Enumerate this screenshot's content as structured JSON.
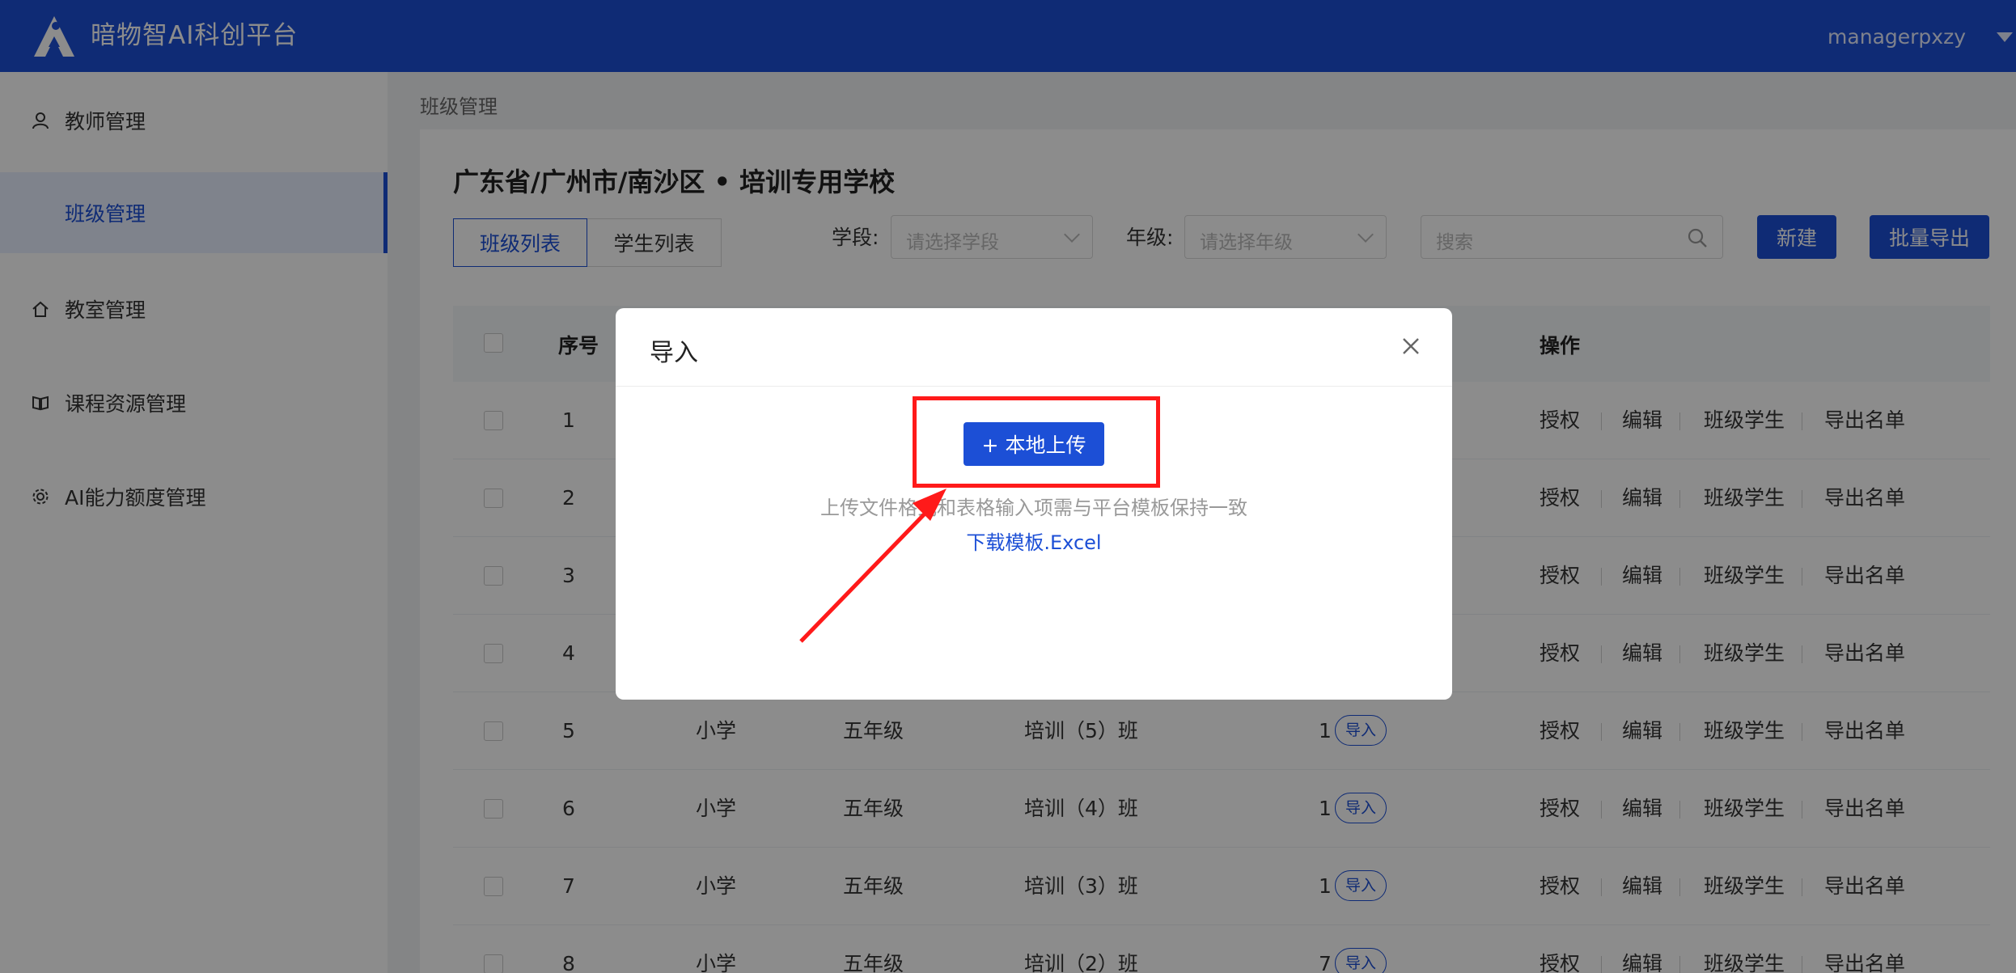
{
  "header": {
    "app_title": "暗物智AI科创平台",
    "user_name": "managerpxzy"
  },
  "sidebar": {
    "items": [
      {
        "label": "教师管理",
        "icon": "user-icon"
      },
      {
        "label": "班级管理",
        "icon": "",
        "active": true
      },
      {
        "label": "教室管理",
        "icon": "home-icon"
      },
      {
        "label": "课程资源管理",
        "icon": "book-icon"
      },
      {
        "label": "AI能力额度管理",
        "icon": "gear-icon"
      }
    ]
  },
  "breadcrumb": "班级管理",
  "main": {
    "school_title": "广东省/广州市/南沙区 • 培训专用学校",
    "tabs": [
      {
        "label": "班级列表",
        "active": true
      },
      {
        "label": "学生列表",
        "active": false
      }
    ],
    "filters": {
      "stage_label": "学段:",
      "stage_placeholder": "请选择学段",
      "grade_label": "年级:",
      "grade_placeholder": "请选择年级",
      "search_placeholder": "搜索"
    },
    "buttons": {
      "new": "新建",
      "export": "批量导出"
    }
  },
  "table": {
    "headers": {
      "index": "序号",
      "actions": "操作"
    },
    "import_label": "导入",
    "actions": [
      "授权",
      "编辑",
      "班级学生",
      "导出名单"
    ],
    "rows": [
      {
        "index": "1",
        "stage": "",
        "grade": "",
        "class_name": "",
        "count": ""
      },
      {
        "index": "2",
        "stage": "",
        "grade": "",
        "class_name": "",
        "count": ""
      },
      {
        "index": "3",
        "stage": "",
        "grade": "",
        "class_name": "",
        "count": ""
      },
      {
        "index": "4",
        "stage": "",
        "grade": "",
        "class_name": "",
        "count": ""
      },
      {
        "index": "5",
        "stage": "小学",
        "grade": "五年级",
        "class_name": "培训（5）班",
        "count": "1"
      },
      {
        "index": "6",
        "stage": "小学",
        "grade": "五年级",
        "class_name": "培训（4）班",
        "count": "1"
      },
      {
        "index": "7",
        "stage": "小学",
        "grade": "五年级",
        "class_name": "培训（3）班",
        "count": "1"
      },
      {
        "index": "8",
        "stage": "小学",
        "grade": "五年级",
        "class_name": "培训（2）班",
        "count": "7"
      }
    ]
  },
  "modal": {
    "title": "导入",
    "upload_label": "+ 本地上传",
    "hint": "上传文件格式和表格输入项需与平台模板保持一致",
    "template_link": "下载模板.Excel"
  },
  "colors": {
    "brand": "#1c4fd6",
    "annotation": "#ff1a1a"
  }
}
